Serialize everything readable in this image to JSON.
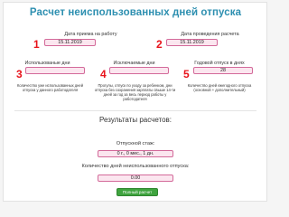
{
  "header": {
    "title": "Расчет неиспользованных дней отпуска"
  },
  "top_left": {
    "number": "1",
    "label": "Дата приема на работу",
    "value": "15.11.2019"
  },
  "top_right": {
    "number": "2",
    "label": "Дата проведения расчета",
    "value": "15.11.2019"
  },
  "mid": [
    {
      "number": "3",
      "label": "Использованые дни",
      "value": "",
      "hint": "Количество уже использованных дней отпуска у данного работодателя"
    },
    {
      "number": "4",
      "label": "Исключаемые дни",
      "value": "",
      "hint": "Прогулы, отпуск по уходу за ребенком, дни отпуска без сохранения зарплаты свыше 14-ти дней за год за весь период работы у работодателя"
    },
    {
      "number": "5",
      "label": "Годовой отпуск в днях",
      "value": "28",
      "hint": "Количество дней ежегодного отпуска (основной + дополнительный)"
    }
  ],
  "results": {
    "title": "Результаты расчетов:",
    "seniority_label": "Отпускной стаж:",
    "seniority_value": "0 г., 0 мес., 1 дн.",
    "unused_label": "Количество дней неиспользованного отпуска:",
    "unused_value": "0.00"
  },
  "actions": {
    "button_label": "Полный расчет"
  },
  "colors": {
    "title": "#2d8fb0",
    "input_fill": "#fbe6ef",
    "input_border": "#d36a9a",
    "number_marker": "#e8121a",
    "button": "#3fa43f"
  }
}
